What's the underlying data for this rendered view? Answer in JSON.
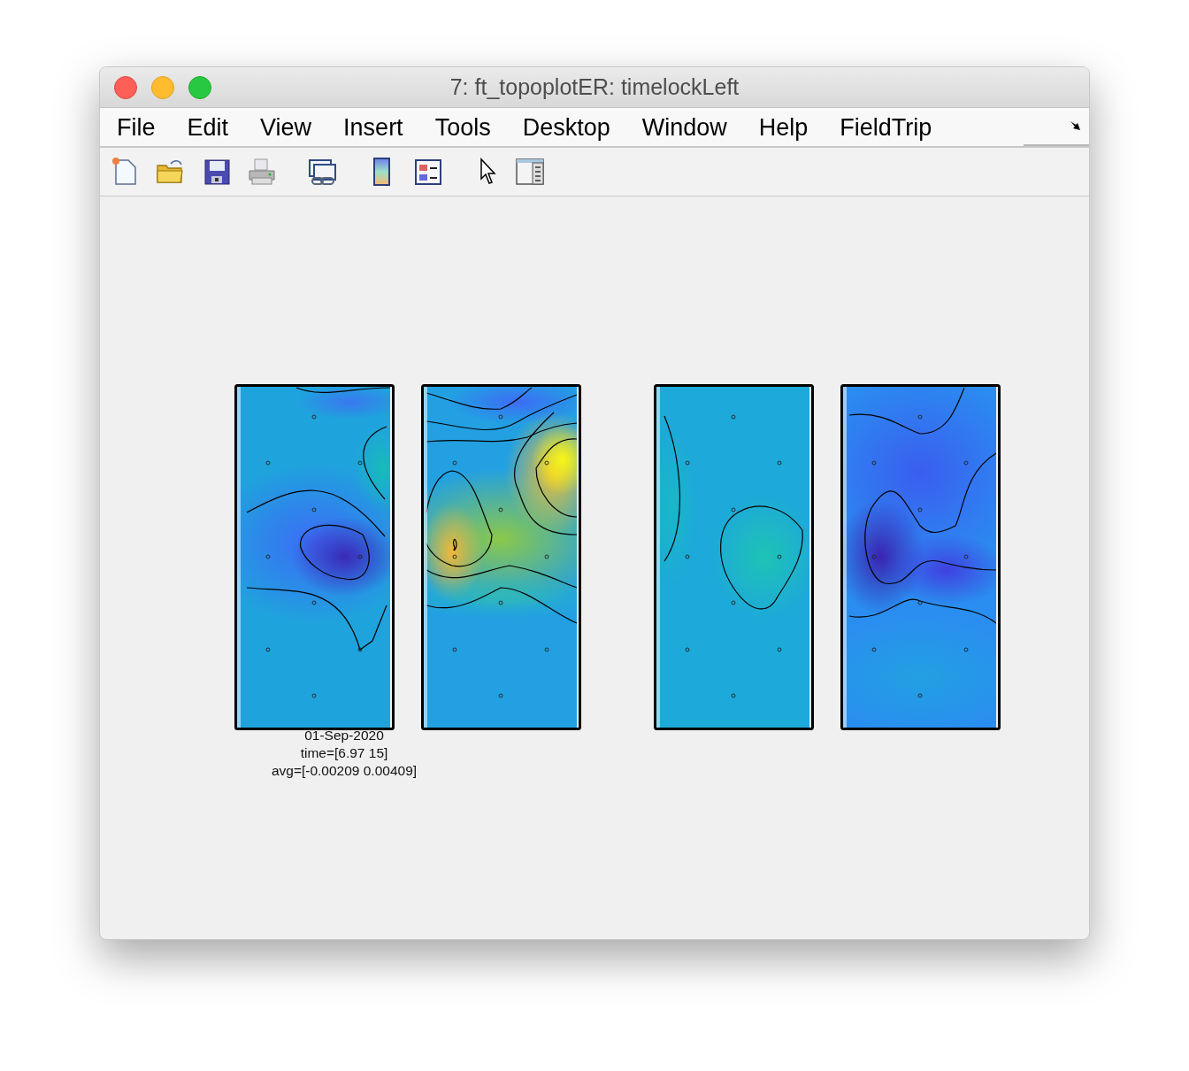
{
  "window": {
    "title": "7: ft_topoplotER: timelockLeft"
  },
  "menu": [
    {
      "label": "File"
    },
    {
      "label": "Edit"
    },
    {
      "label": "View"
    },
    {
      "label": "Insert"
    },
    {
      "label": "Tools"
    },
    {
      "label": "Desktop"
    },
    {
      "label": "Window"
    },
    {
      "label": "Help"
    },
    {
      "label": "FieldTrip"
    }
  ],
  "figure": {
    "annotation": [
      "01-Sep-2020",
      "time=[6.97 15]",
      "avg=[-0.00209 0.00409]"
    ]
  }
}
